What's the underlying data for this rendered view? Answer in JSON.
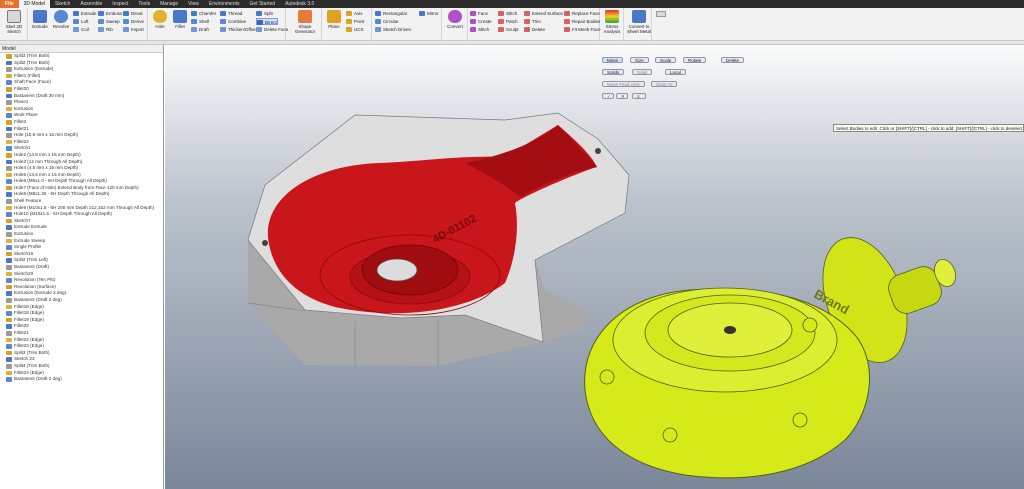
{
  "tabs": [
    "File",
    "3D Model",
    "Sketch",
    "Assemble",
    "Inspect",
    "Tools",
    "Manage",
    "View",
    "Environments",
    "Get Started",
    "Autodesk 3.0"
  ],
  "ribbon": {
    "start_sketch": "Start 2D Sketch",
    "extrude": "Extrude",
    "revolve": "Revolve",
    "sweep_col1": [
      "Extrude",
      "Loft",
      "Coil"
    ],
    "sweep_col2": [
      "Emboss",
      "Sweep",
      "Rib"
    ],
    "sweep_col3": [
      "Decal",
      "Derive",
      "Import"
    ],
    "hole": "Hole",
    "fillet": "Fillet",
    "modify_col1": [
      "Chamfer",
      "Shell",
      "Draft"
    ],
    "modify_col2": [
      "Thread",
      "Combine",
      "Thicken/Offset"
    ],
    "modify_col3": [
      "Split",
      "Direct",
      "Delete Face"
    ],
    "shape_generator": "Shape Generator",
    "plane": "Plane",
    "work_features": [
      "Axis",
      "Point",
      "UCS"
    ],
    "pattern_col1": [
      "Rectangular",
      "Circular",
      "Sketch Driven"
    ],
    "mirror": "Mirror",
    "convert": "Convert",
    "surface_col1": [
      "Face",
      "Create",
      "Stitch"
    ],
    "surface_col2": [
      "Stitch",
      "Patch",
      "Sculpt"
    ],
    "surface_col3": [
      "Extend Surface",
      "Trim",
      "Delete"
    ],
    "surface_col4": [
      "Replace Face",
      "Repair Bodies",
      "Fit Mesh Face"
    ],
    "stress_analysis": "Stress Analysis",
    "convert_sheet": "Convert to Sheet Metal"
  },
  "browser": {
    "title": "Model",
    "items": [
      "Split3 (Trim Both)",
      "Split2 (Trim Both)",
      "Extrusion (Extrude)",
      "Fillet1 (Fillet)",
      "Shaft Face (Face)",
      "Fillet20",
      "Bastanent (Draft 30 mm)",
      "Plane1",
      "Extrusion",
      "Work Plane",
      "Fillet2",
      "Fillet21",
      "Hole (10.5 mm x 15 mm Depth)",
      "Fillet22",
      "Sketch1",
      "Hole2 (14.5 mm x 15 mm Depth)",
      "Hole3 (12 mm Through All Depth)",
      "Hole4 (4.5 mm x 15 mm Depth)",
      "Hole5 (13.5 mm x 15 mm Depth)",
      "Hole6 (M6x1.0 - 6H Depth Through All Depth)",
      "Hole7 (Face of Hole) Extend Body from Face 120 mm Depth)",
      "Hole8 (M8x1.25 - 6H Depth Through All Depth)",
      "Shell Feature",
      "Hole9 (M10x1.5 - 6H 200 mm Depth 212,152 mm Through All Depth)",
      "Hole10 (M10x1.5 - 6H Depth Through All Depth)",
      "Sketch7",
      "Extrude Extrude",
      "Extrusion",
      "Extrude Sweep",
      "Single Profile",
      "Sketch16",
      "Split2 (Trim Left)",
      "Bastanent (Draft)",
      "Sketch20",
      "Revolution (Ten Pitt)",
      "Revolution (Surface)",
      "Extrusion (Extrude 2 deg)",
      "Bastanent (Draft 2 deg)",
      "Fillet18 (Edge)",
      "Fillet18 (Edge)",
      "Fillet19 (Edge)",
      "Fillet20",
      "Fillet21",
      "Fillet22 (Edge)",
      "Fillet23 (Edge)",
      "Split3 (Trim Both)",
      "Sketch 23",
      "Split4 (Trim Both)",
      "Fillet24 (Edge)",
      "Bastanent (Draft 2 deg)"
    ]
  },
  "viewport": {
    "toolbar_row1": [
      "Move",
      "Size",
      "Scale",
      "Rotate",
      "Delete"
    ],
    "toolbar_row2": [
      "Solids",
      "Solid",
      "Local"
    ],
    "toolbar_row3": [
      "Move Triad Only",
      "Snap To"
    ],
    "tooltip": "Select Bodies to edit. Click or [SHIFT]/[CTRL] - click to add; [SHIFT]/[CTRL] - click to deselect",
    "part_label": "4D-01102",
    "housing_label": "Brand"
  },
  "colors": {
    "ribbon_bg": "#f2f2f2",
    "file_tab": "#e8702a",
    "red_face": "#c8161b",
    "yellow_part": "#d6ea1a",
    "grey_body": "#cfcfcf"
  }
}
